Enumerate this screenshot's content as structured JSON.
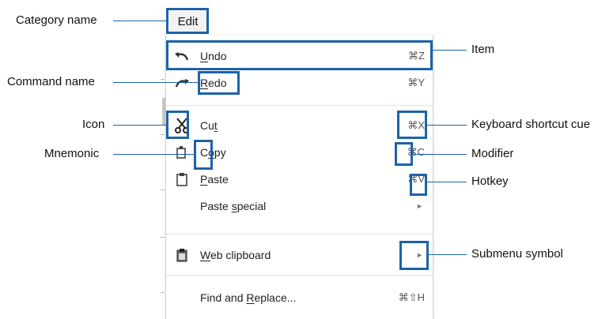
{
  "edit_tab": {
    "label": "Edit"
  },
  "menu": {
    "items": [
      {
        "id": "undo",
        "icon": "undo-arrow-icon",
        "pre": "",
        "mn": "U",
        "post": "ndo",
        "shortcut": "⌘Z"
      },
      {
        "id": "redo",
        "icon": "redo-arrow-icon",
        "pre": "",
        "mn": "R",
        "post": "edo",
        "shortcut": "⌘Y"
      },
      {
        "id": "cut",
        "icon": "scissors-icon",
        "pre": "Cu",
        "mn": "t",
        "post": "",
        "shortcut": "⌘X"
      },
      {
        "id": "copy",
        "icon": "copy-icon",
        "pre": "C",
        "mn": "o",
        "post": "py",
        "shortcut_mod": "⌘",
        "shortcut_key": "C"
      },
      {
        "id": "paste",
        "icon": "clipboard-icon",
        "pre": "",
        "mn": "P",
        "post": "aste",
        "shortcut_mod": "⌘",
        "shortcut_key": "V"
      },
      {
        "id": "paste_special",
        "icon": "",
        "pre": "Paste ",
        "mn": "s",
        "post": "pecial",
        "submenu": "►"
      },
      {
        "id": "web_clipboard",
        "icon": "web-clipboard-icon",
        "pre": "",
        "mn": "W",
        "post": "eb clipboard",
        "submenu": "►"
      },
      {
        "id": "find_replace",
        "icon": "",
        "pre": "Find and ",
        "mn": "R",
        "post": "eplace...",
        "shortcut": "⌘⇧H"
      }
    ]
  },
  "callouts": {
    "category_name": "Category name",
    "command_name": "Command name",
    "icon": "Icon",
    "mnemonic": "Mnemonic",
    "item": "Item",
    "keyboard_shortcut_cue": "Keyboard shortcut cue",
    "modifier": "Modifier",
    "hotkey": "Hotkey",
    "submenu_symbol": "Submenu symbol"
  },
  "colors": {
    "highlight": "#1c63a8",
    "menu_bg": "#ffffff",
    "tab_bg": "#f2f2f2"
  }
}
